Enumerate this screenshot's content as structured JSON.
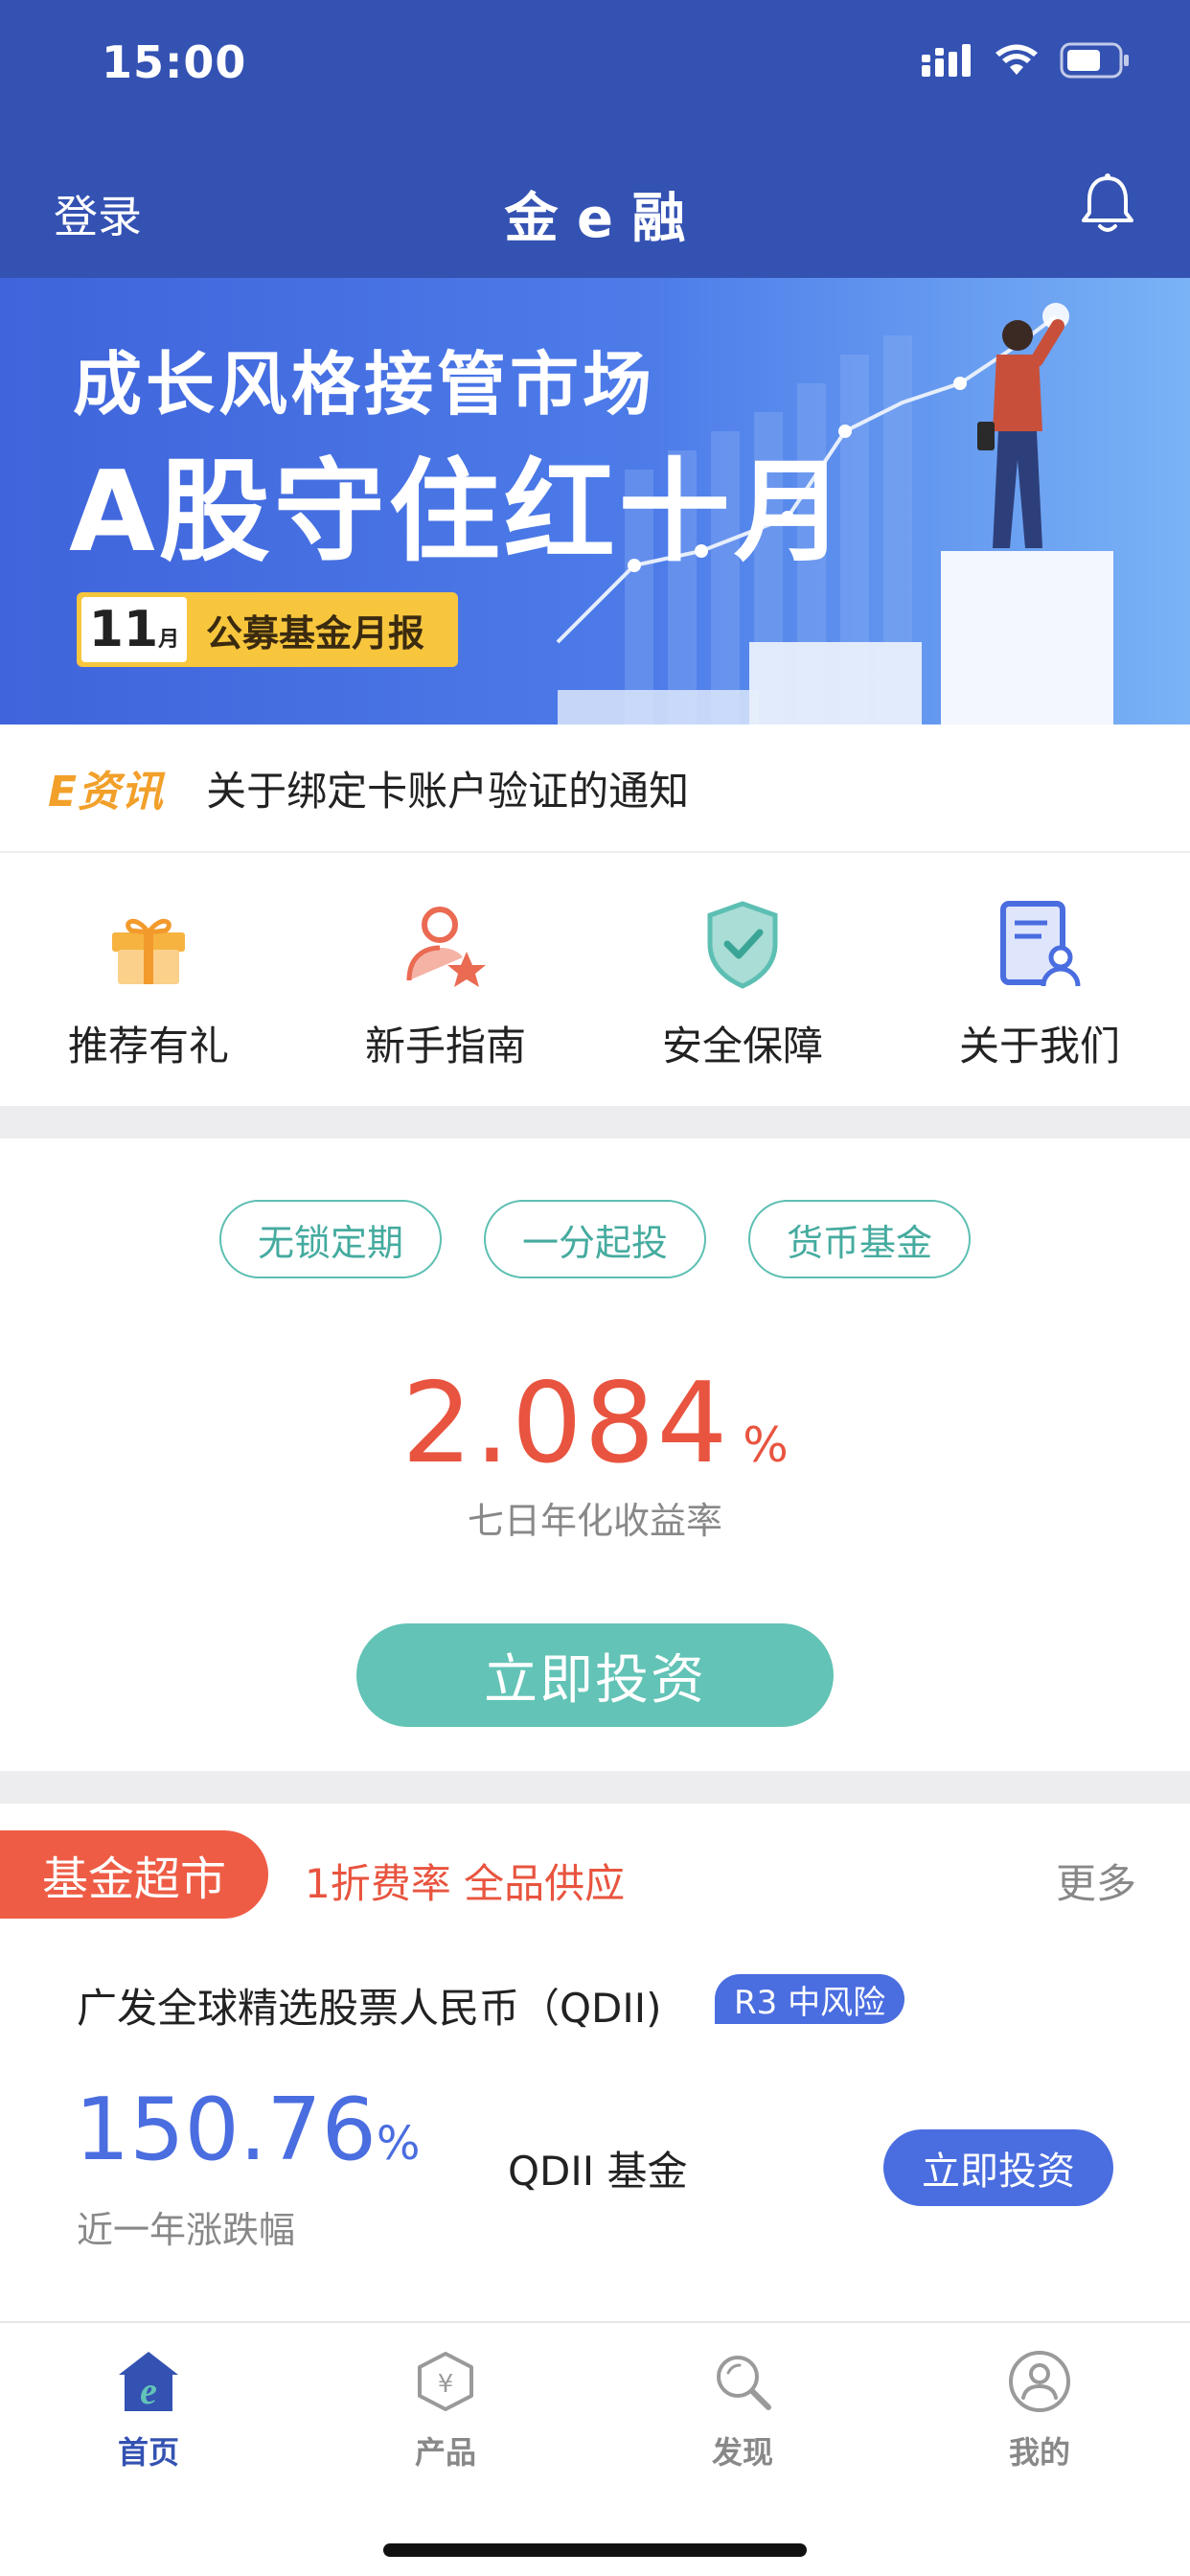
{
  "status_bar": {
    "time": "15:00"
  },
  "nav": {
    "login": "登录",
    "title": "金 e 融"
  },
  "banner": {
    "line1": "成长风格接管市场",
    "line2": "A股守住红十月",
    "tag_number": "11",
    "tag_month": "月",
    "tag_text": "公募基金月报"
  },
  "news": {
    "logo": "E资讯",
    "text": "关于绑定卡账户验证的通知"
  },
  "quick_entries": [
    {
      "label": "推荐有礼",
      "icon": "gift-icon"
    },
    {
      "label": "新手指南",
      "icon": "newbie-guide-icon"
    },
    {
      "label": "安全保障",
      "icon": "shield-check-icon"
    },
    {
      "label": "关于我们",
      "icon": "about-us-icon"
    }
  ],
  "product": {
    "chips": [
      "无锁定期",
      "一分起投",
      "货币基金"
    ],
    "rate": "2.084",
    "rate_unit": "%",
    "rate_label": "七日年化收益率",
    "button": "立即投资"
  },
  "fund_market": {
    "tag": "基金超市",
    "slogan": "1折费率 全品供应",
    "more": "更多",
    "fund_name": "广发全球精选股票人民币（QDII)",
    "risk": "R3 中风险",
    "return_value": "150.76",
    "return_unit": "%",
    "return_label": "近一年涨跌幅",
    "fund_type": "QDII 基金",
    "button": "立即投资"
  },
  "tabbar": [
    {
      "label": "首页",
      "icon": "home-icon",
      "active": true
    },
    {
      "label": "产品",
      "icon": "product-icon",
      "active": false
    },
    {
      "label": "发现",
      "icon": "discover-icon",
      "active": false
    },
    {
      "label": "我的",
      "icon": "profile-icon",
      "active": false
    }
  ],
  "colors": {
    "header": "#3452b2",
    "accent_red": "#e8543f",
    "accent_teal": "#62c3b6",
    "accent_blue": "#4a6de0"
  }
}
